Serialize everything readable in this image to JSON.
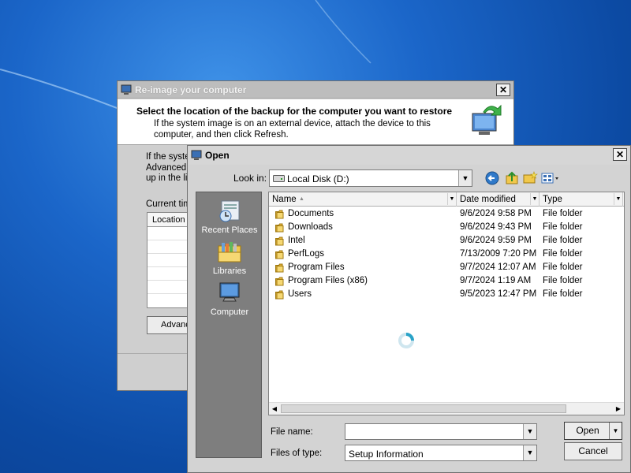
{
  "reimage": {
    "title": "Re-image your computer",
    "heading": "Select the location of the backup for the computer you want to restore",
    "subtext": "If the system image is on an external device, attach the device to this computer, and then click Refresh.",
    "body_lines": [
      "If the syste",
      "Advanced",
      "up in the lis"
    ],
    "current_label": "Current tim",
    "list_column": "Location",
    "advanced_button": "Advanc",
    "close_label": "✕"
  },
  "open_dialog": {
    "title": "Open",
    "close_label": "✕",
    "look_in_label": "Look in:",
    "look_in_value": "Local Disk (D:)",
    "toolbar_icons": [
      "back-icon",
      "up-folder-icon",
      "new-folder-icon",
      "view-menu-icon"
    ],
    "places": [
      "Recent Places",
      "Libraries",
      "Computer"
    ],
    "columns": [
      "Name",
      "Date modified",
      "Type"
    ],
    "files": [
      {
        "name": "Documents",
        "date": "9/6/2024 9:58 PM",
        "type": "File folder"
      },
      {
        "name": "Downloads",
        "date": "9/6/2024 9:43 PM",
        "type": "File folder"
      },
      {
        "name": "Intel",
        "date": "9/6/2024 9:59 PM",
        "type": "File folder"
      },
      {
        "name": "PerfLogs",
        "date": "7/13/2009 7:20 PM",
        "type": "File folder"
      },
      {
        "name": "Program Files",
        "date": "9/7/2024 12:07 AM",
        "type": "File folder"
      },
      {
        "name": "Program Files (x86)",
        "date": "9/7/2024 1:19 AM",
        "type": "File folder"
      },
      {
        "name": "Users",
        "date": "9/5/2023 12:47 PM",
        "type": "File folder"
      }
    ],
    "file_name_label": "File name:",
    "file_name_value": "",
    "file_type_label": "Files of type:",
    "file_type_value": "Setup Information",
    "open_button": "Open",
    "cancel_button": "Cancel"
  },
  "colors": {
    "desktop": "#1b66c9",
    "dialog": "#d3d3d3",
    "places_panel": "#7e7e7e"
  }
}
